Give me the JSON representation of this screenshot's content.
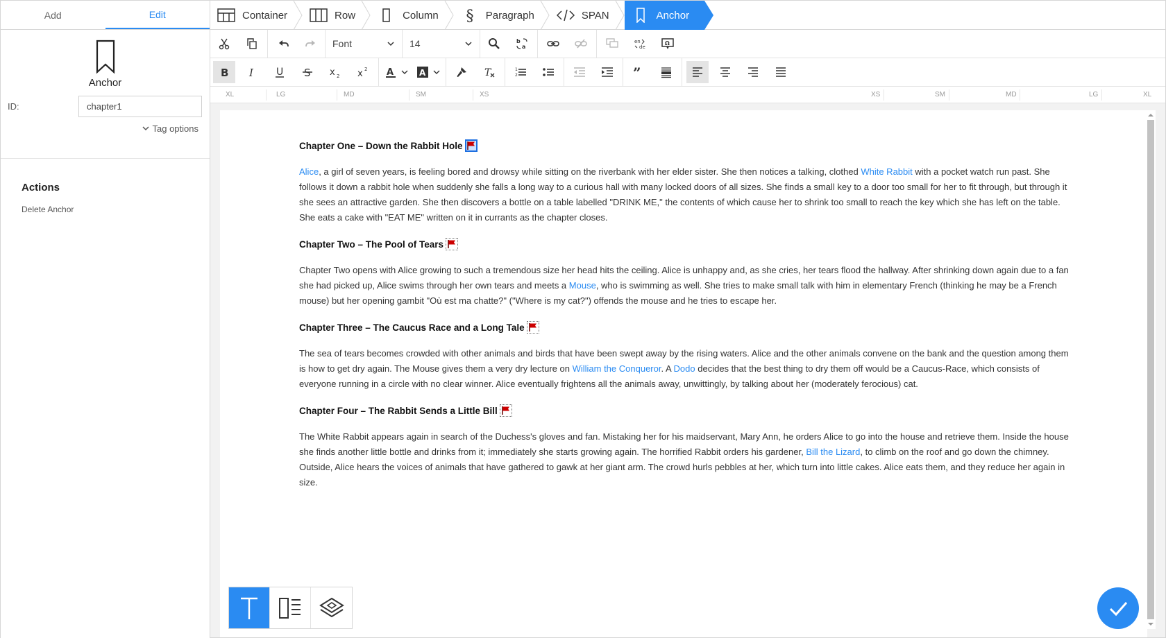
{
  "left_panel": {
    "tabs": [
      {
        "label": "Add"
      },
      {
        "label": "Edit"
      }
    ],
    "element_name": "Anchor",
    "id_label": "ID:",
    "id_value": "chapter1",
    "tag_options": "Tag options",
    "actions_title": "Actions",
    "delete_label": "Delete Anchor"
  },
  "breadcrumb": [
    {
      "label": "Container",
      "icon": "container-icon"
    },
    {
      "label": "Row",
      "icon": "row-icon"
    },
    {
      "label": "Column",
      "icon": "column-icon"
    },
    {
      "label": "Paragraph",
      "icon": "paragraph-icon"
    },
    {
      "label": "SPAN",
      "icon": "code-icon"
    },
    {
      "label": "Anchor",
      "icon": "bookmark-icon"
    }
  ],
  "toolbar": {
    "font_label": "Font",
    "size_label": "14"
  },
  "ruler": {
    "left": [
      "XL",
      "LG",
      "MD",
      "SM",
      "XS"
    ],
    "right": [
      "XS",
      "SM",
      "MD",
      "LG",
      "XL"
    ]
  },
  "document": {
    "ch1_title": "Chapter One – Down the Rabbit Hole",
    "ch1_link_alice": "Alice",
    "ch1_t1": ", a girl of seven years, is feeling bored and drowsy while sitting on the riverbank with her elder sister. She then notices a talking, clothed ",
    "ch1_link_rabbit": "White Rabbit",
    "ch1_t2": " with a pocket watch run past. She follows it down a rabbit hole when suddenly she falls a long way to a curious hall with many locked doors of all sizes. She finds a small key to a door too small for her to fit through, but through it she sees an attractive garden. She then discovers a bottle on a table labelled \"DRINK ME,\" the contents of which cause her to shrink too small to reach the key which she has left on the table. She eats a cake with \"EAT ME\" written on it in currants as the chapter closes.",
    "ch2_title": "Chapter Two – The Pool of Tears",
    "ch2_t1": "Chapter Two opens with Alice growing to such a tremendous size her head hits the ceiling. Alice is unhappy and, as she cries, her tears flood the hallway. After shrinking down again due to a fan she had picked up, Alice swims through her own tears and meets a ",
    "ch2_link_mouse": "Mouse",
    "ch2_t2": ", who is swimming as well. She tries to make small talk with him in elementary French (thinking he may be a French mouse) but her opening gambit \"Où est ma chatte?\" (\"Where is my cat?\") offends the mouse and he tries to escape her.",
    "ch3_title": "Chapter Three – The Caucus Race and a Long Tale",
    "ch3_t1": "The sea of tears becomes crowded with other animals and birds that have been swept away by the rising waters. Alice and the other animals convene on the bank and the question among them is how to get dry again. The Mouse gives them a very dry lecture on ",
    "ch3_link_william": "William the Conqueror",
    "ch3_t2": ". A ",
    "ch3_link_dodo": "Dodo",
    "ch3_t3": " decides that the best thing to dry them off would be a Caucus-Race, which consists of everyone running in a circle with no clear winner. Alice eventually frightens all the animals away, unwittingly, by talking about her (moderately ferocious) cat.",
    "ch4_title": "Chapter Four – The Rabbit Sends a Little Bill",
    "ch4_t1": "The White Rabbit appears again in search of the Duchess's gloves and fan. Mistaking her for his maidservant, Mary Ann, he orders Alice to go into the house and retrieve them. Inside the house she finds another little bottle and drinks from it; immediately she starts growing again. The horrified Rabbit orders his gardener, ",
    "ch4_link_bill": "Bill the Lizard",
    "ch4_t2": ", to climb on the roof and go down the chimney. Outside, Alice hears the voices of animals that have gathered to gawk at her giant arm. The crowd hurls pebbles at her, which turn into little cakes. Alice eats them, and they reduce her again in size."
  },
  "colors": {
    "accent": "#2a8bf2",
    "flag": "#cc0000"
  }
}
